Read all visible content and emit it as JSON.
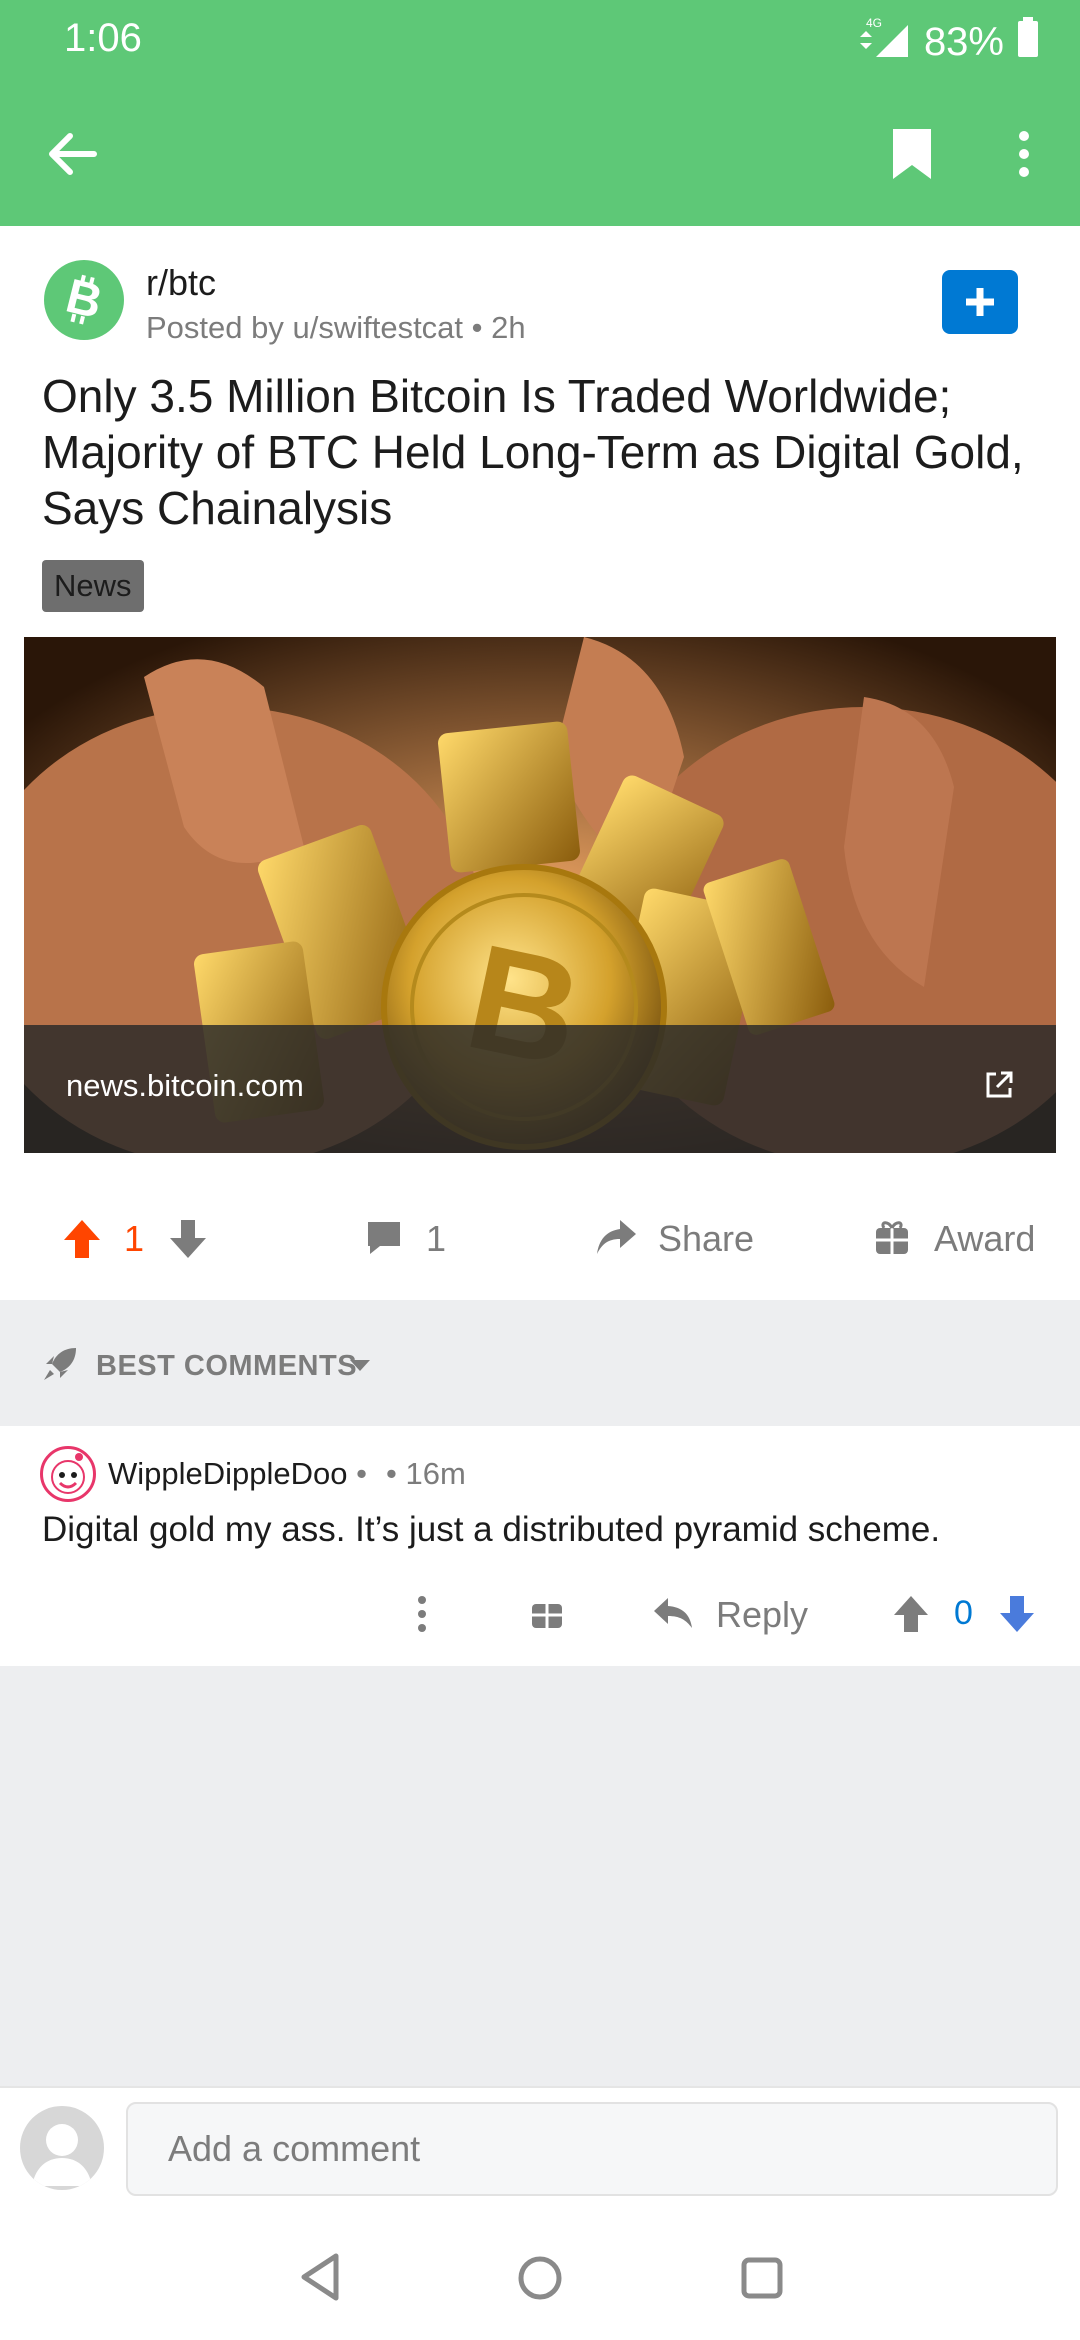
{
  "status_bar": {
    "time": "1:06",
    "network": "4G",
    "battery": "83%"
  },
  "app_bar": {
    "back_icon": "arrow-left-icon",
    "bookmark_icon": "bookmark-icon",
    "more_icon": "more-vertical-icon"
  },
  "post": {
    "subreddit": "r/btc",
    "meta": "Posted by u/swiftestcat • 2h",
    "title": "Only 3.5 Million Bitcoin Is Traded Worldwide; Majority of BTC Held Long-Term as Digital Gold, Says Chainalysis",
    "flair": "News",
    "link_domain": "news.bitcoin.com",
    "score": "1",
    "comments_count": "1",
    "share_label": "Share",
    "award_label": "Award"
  },
  "comments_section": {
    "sort_label": "BEST COMMENTS",
    "comments": [
      {
        "author": "WippleDippleDoo",
        "separator": "•",
        "time": "• 16m",
        "body": "Digital gold my ass. It’s just a distributed pyramid scheme.",
        "reply_label": "Reply",
        "score": "0"
      }
    ]
  },
  "composer": {
    "placeholder": "Add a comment"
  },
  "colors": {
    "brand_green": "#5ec877",
    "upvote_orange": "#ff4500",
    "blue": "#0079d3",
    "grey_text": "#7c7c7c"
  }
}
